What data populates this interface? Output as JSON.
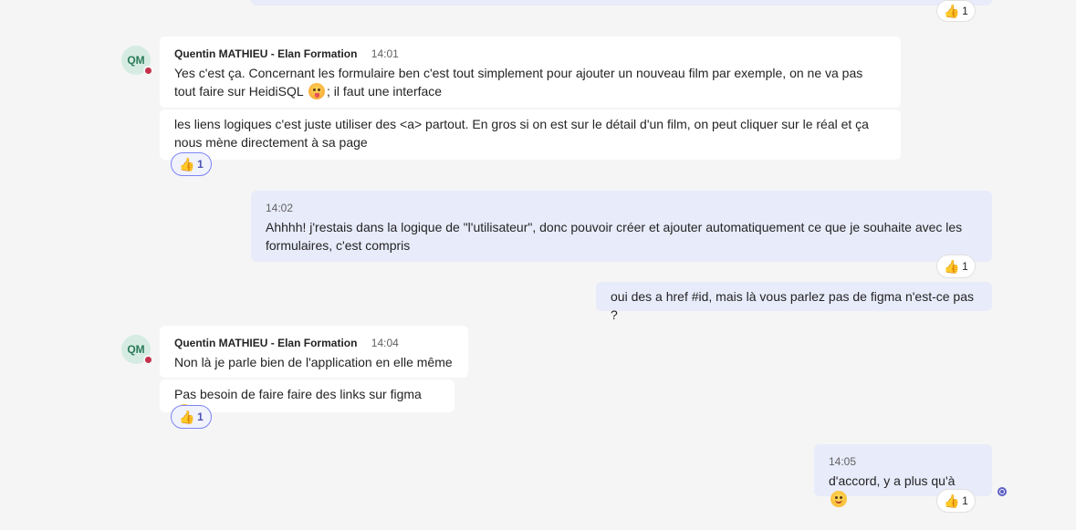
{
  "colors": {
    "background": "#f5f5f5",
    "own_bubble": "#e8ebfa",
    "other_bubble": "#ffffff",
    "avatar_bg": "#d6ece3",
    "presence_busy": "#c4314b",
    "accent": "#5b5fc7"
  },
  "top": {
    "reaction_count": "1",
    "reaction_icon": "thumbs-up-icon"
  },
  "group1": {
    "avatar_initials": "QM",
    "sender": "Quentin MATHIEU - Elan Formation",
    "time": "14:01",
    "msg1_part1": "Yes c'est ça. Concernant les formulaire ben c'est tout simplement pour ajouter un nouveau film par exemple, on ne va pas tout faire sur HeidiSQL",
    "msg1_part2": "; il faut une interface",
    "msg2": "les liens logiques c'est juste utiliser des <a> partout. En gros si on est sur le détail d'un film, on peut cliquer sur le réal et ça nous mène directement à sa page",
    "reaction_count": "1"
  },
  "own1": {
    "time": "14:02",
    "text": "Ahhhh! j'restais dans la logique de \"l'utilisateur\", donc pouvoir créer et ajouter automatiquement ce que je souhaite avec les formulaires, c'est compris",
    "reaction_count": "1"
  },
  "own2": {
    "text": "oui des a href #id, mais là vous parlez pas de figma n'est-ce pas ?"
  },
  "group2": {
    "avatar_initials": "QM",
    "sender": "Quentin MATHIEU - Elan Formation",
    "time": "14:04",
    "msg1": "Non là je parle bien de l'application en elle même",
    "msg2": "Pas besoin de faire faire des links sur figma",
    "reaction_count": "1"
  },
  "own3": {
    "time": "14:05",
    "text": "d'accord, y a plus qu'à",
    "reaction_count": "1"
  }
}
